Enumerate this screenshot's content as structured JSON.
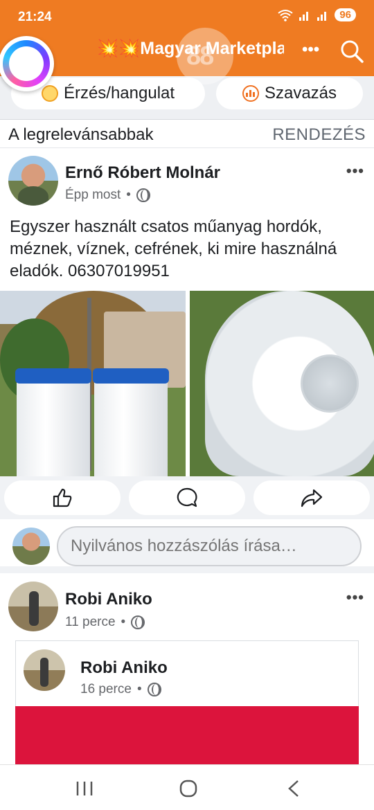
{
  "status": {
    "time": "21:24",
    "battery": "96"
  },
  "header": {
    "title": "💥💥Magyar Marketplace..."
  },
  "chips": {
    "feeling": "Érzés/hangulat",
    "poll": "Szavazás"
  },
  "sort": {
    "label": "A legrelevánsabbak",
    "action": "RENDEZÉS"
  },
  "post1": {
    "author": "Ernő Róbert Molnár",
    "time": "Épp most",
    "separator": "•",
    "text": "Egyszer használt csatos műanyag hordók, méznek, víznek,  cefrének, ki mire használná eladók. 06307019951"
  },
  "comment": {
    "placeholder": "Nyilvános hozzászólás írása…"
  },
  "post2": {
    "author": "Robi Aniko",
    "time": "11 perce",
    "separator": "•"
  },
  "shared": {
    "author": "Robi Aniko",
    "time": "16 perce",
    "separator": "•"
  },
  "colors": {
    "brand": "#ef7b22",
    "accent_red": "#dc143c"
  },
  "icons": [
    "assistant-bubble-icon",
    "more-icon",
    "search-icon",
    "smiley-icon",
    "poll-icon",
    "globe-icon",
    "like-icon",
    "comment-icon",
    "share-icon",
    "recent-apps-icon",
    "home-icon",
    "back-icon"
  ]
}
